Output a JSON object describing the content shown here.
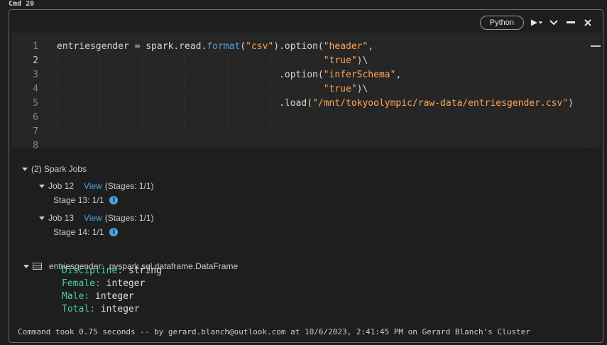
{
  "cell": {
    "label": "Cmd 20",
    "language": "Python"
  },
  "toolbar_icons": [
    "run-dropdown-icon",
    "collapse-icon",
    "minimize-icon",
    "close-icon"
  ],
  "code": {
    "line_numbers": [
      "1",
      "2",
      "3",
      "4",
      "5",
      "6",
      "7",
      "8"
    ],
    "active_line": 2,
    "lines": [
      [
        {
          "t": "plain",
          "v": "entriesgender = spark.read."
        },
        {
          "t": "fn",
          "v": "format"
        },
        {
          "t": "plain",
          "v": "("
        },
        {
          "t": "str",
          "v": "\"csv\""
        },
        {
          "t": "plain",
          "v": ").option("
        },
        {
          "t": "str",
          "v": "\"header\""
        },
        {
          "t": "plain",
          "v": ","
        }
      ],
      [
        {
          "t": "plain",
          "v": "                                                "
        },
        {
          "t": "str",
          "v": "\"true\""
        },
        {
          "t": "plain",
          "v": ")\\"
        }
      ],
      [
        {
          "t": "plain",
          "v": "                                        .option("
        },
        {
          "t": "str",
          "v": "\"inferSchema\""
        },
        {
          "t": "plain",
          "v": ","
        }
      ],
      [
        {
          "t": "plain",
          "v": "                                                "
        },
        {
          "t": "str",
          "v": "\"true\""
        },
        {
          "t": "plain",
          "v": ")\\"
        }
      ],
      [
        {
          "t": "plain",
          "v": "                                        .load("
        },
        {
          "t": "str",
          "v": "\"/mnt/tokyoolympic/raw-data/entriesgender.csv\""
        },
        {
          "t": "plain",
          "v": ")"
        }
      ],
      [],
      [],
      []
    ]
  },
  "spark_jobs": {
    "header": "(2) Spark Jobs",
    "jobs": [
      {
        "label": "Job 12",
        "link": "View",
        "stages": "(Stages: 1/1)",
        "stage_detail": "Stage 13: 1/1"
      },
      {
        "label": "Job 13",
        "link": "View",
        "stages": "(Stages: 1/1)",
        "stage_detail": "Stage 14: 1/1"
      }
    ]
  },
  "dataframe": {
    "name": "entriesgender:",
    "type": "pyspark.sql.dataframe.DataFrame",
    "schema": [
      {
        "name": "Discipline:",
        "type": "string"
      },
      {
        "name": "Female:",
        "type": "integer"
      },
      {
        "name": "Male:",
        "type": "integer"
      },
      {
        "name": "Total:",
        "type": "integer"
      }
    ]
  },
  "footer": {
    "text": "Command took 0.75 seconds -- by gerard.blanch@outlook.com at 10/6/2023, 2:41:45 PM on Gerard Blanch's Cluster"
  },
  "colors": {
    "background": "#1e1e1e",
    "editor_bg": "#262626",
    "string": "#ffa657",
    "function": "#569cd6",
    "link": "#4aa3df",
    "schema_name": "#4ec9b0"
  }
}
